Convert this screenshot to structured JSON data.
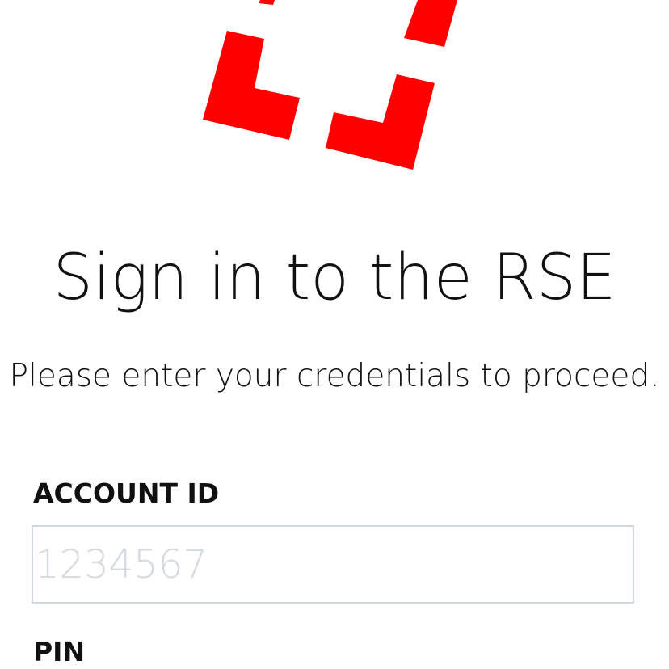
{
  "logo": {
    "color": "#ff0000",
    "icon": "brackets-logo-icon"
  },
  "header": {
    "title": "Sign in to the RSE",
    "subtitle": "Please enter your credentials to proceed."
  },
  "form": {
    "account_id": {
      "label": "ACCOUNT ID",
      "value": "",
      "placeholder": "1234567"
    },
    "pin": {
      "label": "PIN"
    }
  },
  "colors": {
    "text": "#111111",
    "input_border": "#cfd8e0",
    "placeholder": "#d4dae0"
  }
}
